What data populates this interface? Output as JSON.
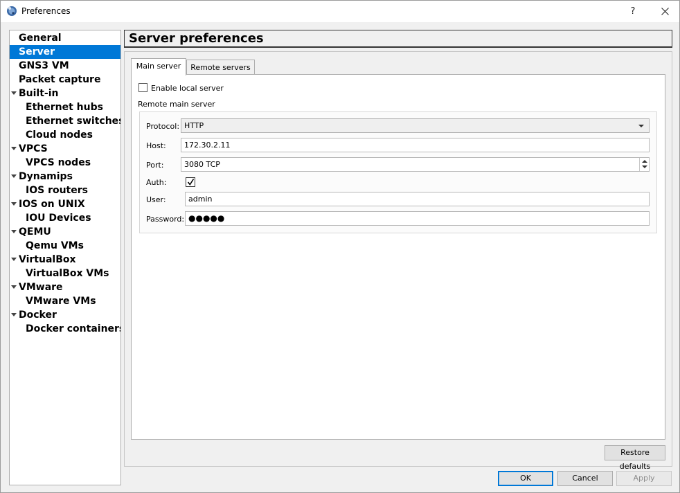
{
  "window": {
    "title": "Preferences",
    "help_glyph": "?",
    "close_glyph": "✕"
  },
  "tree": {
    "items": [
      {
        "label": "General",
        "level": 0,
        "expandable": false,
        "selected": false
      },
      {
        "label": "Server",
        "level": 0,
        "expandable": false,
        "selected": true
      },
      {
        "label": "GNS3 VM",
        "level": 0,
        "expandable": false,
        "selected": false
      },
      {
        "label": "Packet capture",
        "level": 0,
        "expandable": false,
        "selected": false
      },
      {
        "label": "Built-in",
        "level": 0,
        "expandable": true,
        "selected": false
      },
      {
        "label": "Ethernet hubs",
        "level": 1,
        "expandable": false,
        "selected": false
      },
      {
        "label": "Ethernet switches",
        "level": 1,
        "expandable": false,
        "selected": false
      },
      {
        "label": "Cloud nodes",
        "level": 1,
        "expandable": false,
        "selected": false
      },
      {
        "label": "VPCS",
        "level": 0,
        "expandable": true,
        "selected": false
      },
      {
        "label": "VPCS nodes",
        "level": 1,
        "expandable": false,
        "selected": false
      },
      {
        "label": "Dynamips",
        "level": 0,
        "expandable": true,
        "selected": false
      },
      {
        "label": "IOS routers",
        "level": 1,
        "expandable": false,
        "selected": false
      },
      {
        "label": "IOS on UNIX",
        "level": 0,
        "expandable": true,
        "selected": false
      },
      {
        "label": "IOU Devices",
        "level": 1,
        "expandable": false,
        "selected": false
      },
      {
        "label": "QEMU",
        "level": 0,
        "expandable": true,
        "selected": false
      },
      {
        "label": "Qemu VMs",
        "level": 1,
        "expandable": false,
        "selected": false
      },
      {
        "label": "VirtualBox",
        "level": 0,
        "expandable": true,
        "selected": false
      },
      {
        "label": "VirtualBox VMs",
        "level": 1,
        "expandable": false,
        "selected": false
      },
      {
        "label": "VMware",
        "level": 0,
        "expandable": true,
        "selected": false
      },
      {
        "label": "VMware VMs",
        "level": 1,
        "expandable": false,
        "selected": false
      },
      {
        "label": "Docker",
        "level": 0,
        "expandable": true,
        "selected": false
      },
      {
        "label": "Docker containers",
        "level": 1,
        "expandable": false,
        "selected": false
      }
    ]
  },
  "header": {
    "title": "Server preferences"
  },
  "tabs": [
    {
      "label": "Main server",
      "active": true
    },
    {
      "label": "Remote servers",
      "active": false
    }
  ],
  "main_server": {
    "enable_local_label": "Enable local server",
    "enable_local_checked": false,
    "group_title": "Remote main server",
    "protocol_label": "Protocol:",
    "protocol_value": "HTTP",
    "host_label": "Host:",
    "host_value": "172.30.2.11",
    "port_label": "Port:",
    "port_value": "3080 TCP",
    "auth_label": "Auth:",
    "auth_checked": true,
    "user_label": "User:",
    "user_value": "admin",
    "password_label": "Password:",
    "password_value": "●●●●●"
  },
  "buttons": {
    "restore_defaults": "Restore defaults",
    "ok": "OK",
    "cancel": "Cancel",
    "apply": "Apply"
  },
  "colors": {
    "selection": "#0078d7",
    "window_bg": "#f0f0f0"
  }
}
